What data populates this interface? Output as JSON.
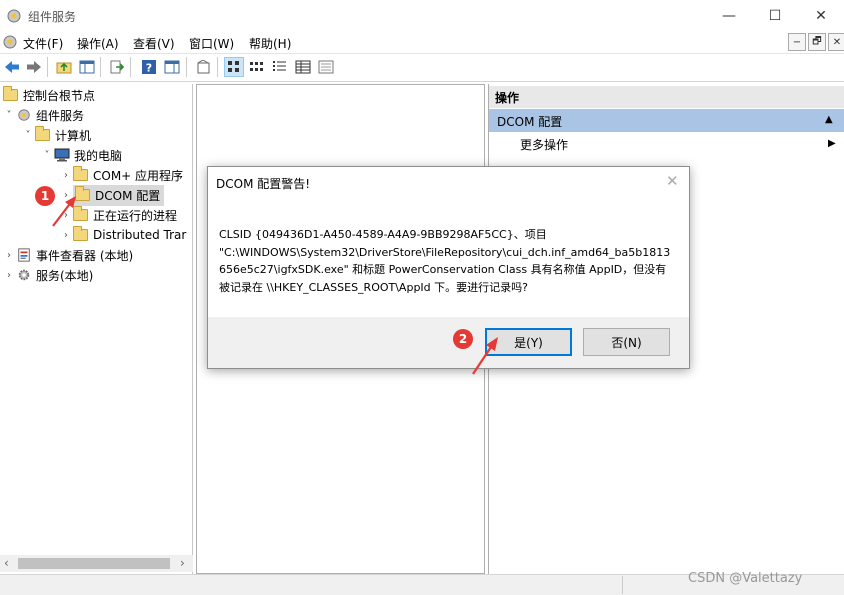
{
  "window": {
    "title": "组件服务",
    "controls": {
      "minimize": "—",
      "maximize": "☐",
      "close": "✕"
    }
  },
  "menu": {
    "items": [
      "文件(F)",
      "操作(A)",
      "查看(V)",
      "窗口(W)",
      "帮助(H)"
    ],
    "mdi_controls": [
      "−",
      "🗗",
      "✕"
    ]
  },
  "toolbar": {
    "icons": [
      "back-icon",
      "forward-icon",
      "up-folder-icon",
      "show-hide-tree-icon",
      "export-list-icon",
      "help-icon",
      "show-hide-action-pane-icon",
      "new-window-icon",
      "large-icons-view-icon",
      "small-icons-view-icon",
      "list-view-icon",
      "detail-view-icon",
      "properties-icon"
    ]
  },
  "tree": {
    "items": [
      {
        "label": "控制台根节点",
        "toggle": "",
        "icon": "folder-icon"
      },
      {
        "label": "组件服务",
        "toggle": "˅",
        "icon": "component-services-icon"
      },
      {
        "label": "计算机",
        "toggle": "˅",
        "icon": "folder-icon"
      },
      {
        "label": "我的电脑",
        "toggle": "˅",
        "icon": "computer-icon"
      },
      {
        "label": "COM+ 应用程序",
        "toggle": "›",
        "icon": "folder-icon"
      },
      {
        "label": "DCOM 配置",
        "toggle": "›",
        "icon": "folder-icon",
        "selected": true
      },
      {
        "label": "正在运行的进程",
        "toggle": "›",
        "icon": "folder-icon"
      },
      {
        "label": "Distributed Trar",
        "toggle": "›",
        "icon": "folder-icon"
      },
      {
        "label": "事件查看器 (本地)",
        "toggle": "›",
        "icon": "event-viewer-icon"
      },
      {
        "label": "服务(本地)",
        "toggle": "›",
        "icon": "services-icon"
      }
    ]
  },
  "actions": {
    "header": "操作",
    "section": "DCOM 配置",
    "section_arrow": "▲",
    "more": "更多操作",
    "more_arrow": "▶"
  },
  "dialog": {
    "title": "DCOM 配置警告!",
    "close": "✕",
    "body_lines": [
      "CLSID {049436D1-A450-4589-A4A9-9BB9298AF5CC}、项目",
      "\"C:\\WINDOWS\\System32\\DriverStore\\FileRepository\\cui_dch.inf_amd64_ba5b1813",
      "656e5c27\\igfxSDK.exe\" 和标题 PowerConservation Class 具有名称值 AppID，但没有",
      "被记录在 \\\\HKEY_CLASSES_ROOT\\AppId 下。要进行记录吗?"
    ],
    "yes_button": "是(Y)",
    "no_button": "否(N)"
  },
  "annotations": {
    "badge_1": "1",
    "badge_2": "2",
    "color": "#e53935"
  },
  "scroll": {
    "left_arrow": "‹",
    "right_arrow": "›"
  },
  "watermark": "CSDN @Valettazy"
}
